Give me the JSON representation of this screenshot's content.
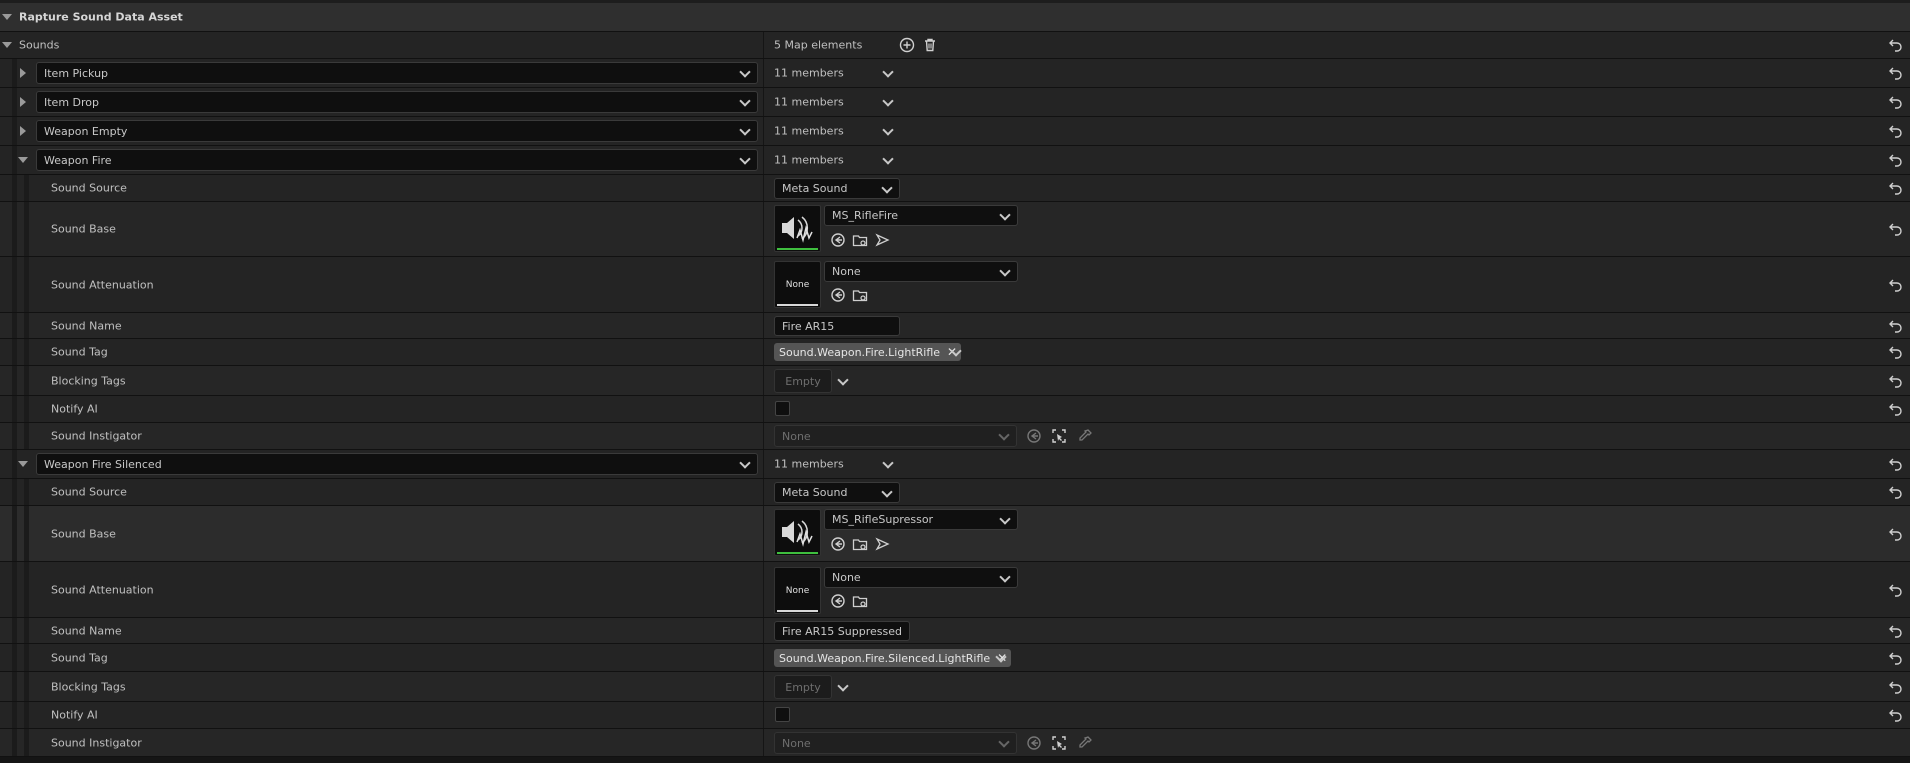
{
  "asset_title": "Rapture Sound Data Asset",
  "sounds": {
    "label": "Sounds",
    "count_label": "5 Map elements"
  },
  "colors": {
    "accent_green": "#3fbf3f",
    "none_underline": "#d8d8d8"
  },
  "keys": [
    {
      "key": "Item Pickup",
      "members": "11 members"
    },
    {
      "key": "Item Drop",
      "members": "11 members"
    },
    {
      "key": "Weapon Empty",
      "members": "11 members"
    },
    {
      "key": "Weapon Fire",
      "members": "11 members"
    },
    {
      "key": "Weapon Fire Silenced",
      "members": "11 members"
    }
  ],
  "labels": {
    "sound_source": "Sound Source",
    "sound_base": "Sound Base",
    "sound_attenuation": "Sound Attenuation",
    "sound_name": "Sound Name",
    "sound_tag": "Sound Tag",
    "blocking_tags": "Blocking Tags",
    "notify_ai": "Notify AI",
    "sound_instigator": "Sound Instigator"
  },
  "weapon_fire": {
    "sound_source": "Meta Sound",
    "sound_base": "MS_RifleFire",
    "sound_attenuation": "None",
    "attenuation_thumb": "None",
    "sound_name": "Fire AR15",
    "sound_tag": "Sound.Weapon.Fire.LightRifle",
    "blocking_tags": "Empty",
    "sound_instigator": "None"
  },
  "weapon_fire_silenced": {
    "sound_source": "Meta Sound",
    "sound_base": "MS_RifleSupressor",
    "sound_attenuation": "None",
    "attenuation_thumb": "None",
    "sound_name": "Fire AR15 Suppressed",
    "sound_tag": "Sound.Weapon.Fire.Silenced.LightRifle",
    "blocking_tags": "Empty",
    "sound_instigator": "None"
  },
  "icons": {
    "add": "plus-circle-icon",
    "delete": "trash-icon",
    "reset": "reset-arrow-icon",
    "use_selected": "use-selected-arrow-icon",
    "browse": "browse-folder-icon",
    "play": "play-icon",
    "picker": "eyedropper-icon",
    "pick_actor": "pick-actor-icon",
    "sound_wave": "sound-wave-icon"
  }
}
